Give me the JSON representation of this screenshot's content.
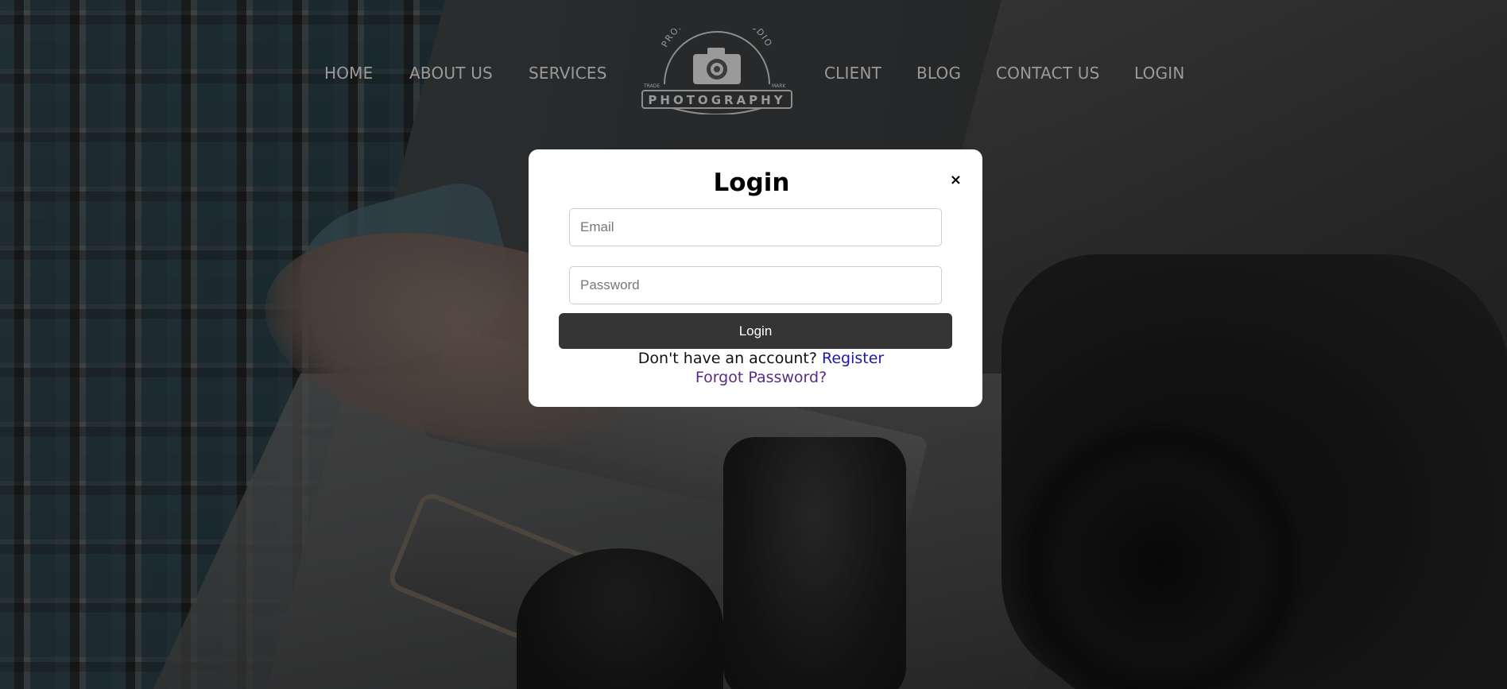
{
  "nav": {
    "home": "HOME",
    "about": "ABOUT US",
    "services": "SERVICES",
    "client": "CLIENT",
    "blog": "BLOG",
    "contact": "CONTACT US",
    "login": "LOGIN"
  },
  "logo": {
    "arc_text": "PROFESSIONAL STUDIO",
    "wordmark": "PHOTOGRAPHY",
    "left_tag": "TRADE",
    "right_tag": "MARK",
    "icon": "camera-icon"
  },
  "modal": {
    "title": "Login",
    "close_label": "×",
    "email_placeholder": "Email",
    "password_placeholder": "Password",
    "submit_label": "Login",
    "no_account_text": "Don't have an account?",
    "register_label": "Register",
    "forgot_label": "Forgot Password?"
  },
  "colors": {
    "nav_text": "#9a9a9a",
    "button_bg": "#353535",
    "register_link": "#1a1aa6",
    "forgot_link": "#5a2a86"
  }
}
